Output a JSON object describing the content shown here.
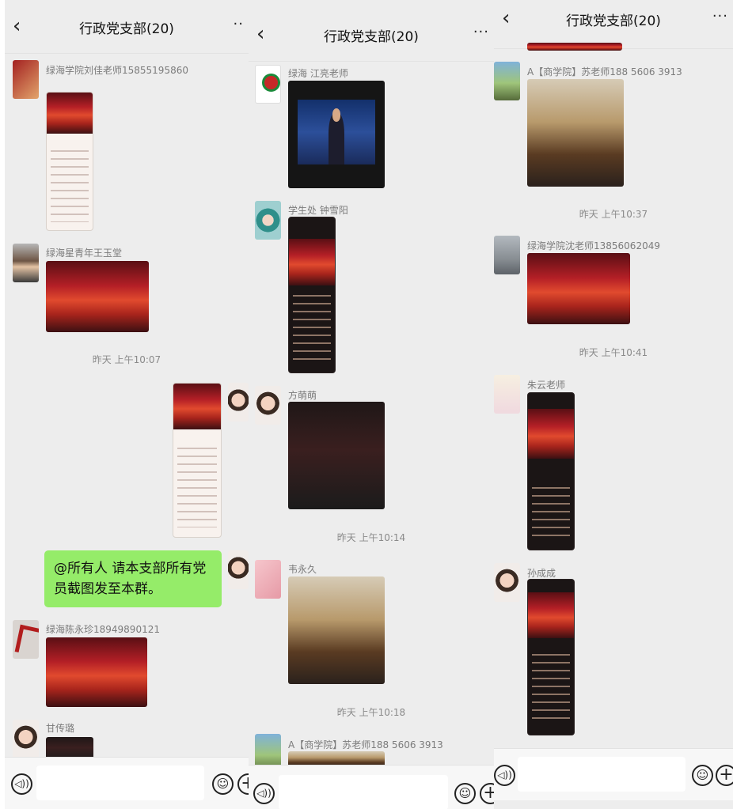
{
  "panels": [
    {
      "title": "行政党支部(20)",
      "back_icon": "‹",
      "more_icon": "··",
      "senders": [
        "绿海学院刘佳老师15855195860",
        "绿海星青年王玉堂",
        "绿海陈永珍18949890121",
        "甘传璐"
      ],
      "times": [
        "昨天 上午10:07"
      ],
      "message_text": "@所有人  请本支部所有党员截图发至本群。"
    },
    {
      "title": "行政党支部(20)",
      "back_icon": "‹",
      "more_icon": "···",
      "senders": [
        "绿海 江亮老师",
        "学生处 钟雪阳",
        "方萌萌",
        "韦永久",
        "A【商学院】苏老师188 5606 3913"
      ],
      "times": [
        "昨天 上午10:14",
        "昨天 上午10:18"
      ]
    },
    {
      "title": "行政党支部(20)",
      "back_icon": "‹",
      "more_icon": "···",
      "senders": [
        "A【商学院】苏老师188 5606 3913",
        "绿海学院沈老师13856062049",
        "朱云老师",
        "孙成成"
      ],
      "times": [
        "昨天 上午10:37",
        "昨天 上午10:41"
      ]
    }
  ],
  "input_bar": {
    "voice_icon": "◁))",
    "emoji_icon": "☺",
    "plus_icon": "+"
  }
}
